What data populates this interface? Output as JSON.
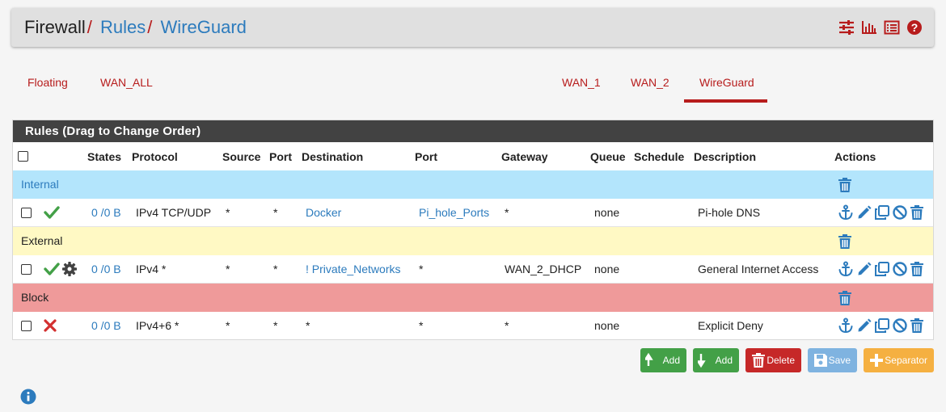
{
  "breadcrumb": {
    "root": "Firewall",
    "sep1": "/",
    "rules": "Rules",
    "sep2": "/",
    "current": "WireGuard"
  },
  "header_icons": [
    "sliders-icon",
    "bar-chart-icon",
    "list-icon",
    "help-icon"
  ],
  "tabs": [
    {
      "label": "Floating",
      "active": false
    },
    {
      "label": "WAN_ALL",
      "active": false
    },
    {
      "label": "WAN_1",
      "active": false
    },
    {
      "label": "WAN_2",
      "active": false
    },
    {
      "label": "WireGuard",
      "active": true
    }
  ],
  "panel": {
    "title": "Rules (Drag to Change Order)"
  },
  "columns": [
    "States",
    "Protocol",
    "Source",
    "Port",
    "Destination",
    "Port",
    "Gateway",
    "Queue",
    "Schedule",
    "Description",
    "Actions"
  ],
  "separators": [
    {
      "label": "Internal",
      "color": "#b3e5fc"
    },
    {
      "label": "External",
      "color": "#fff9c4"
    },
    {
      "label": "Block",
      "color": "#ef9a9a"
    }
  ],
  "rows": [
    {
      "status": "pass",
      "advanced": false,
      "states": "0 /0 B",
      "protocol": "IPv4 TCP/UDP",
      "source": "*",
      "source_port": "*",
      "destination": "Docker",
      "dest_port": "Pi_hole_Ports",
      "gateway": "*",
      "queue": "none",
      "schedule": "",
      "description": "Pi-hole DNS"
    },
    {
      "status": "pass",
      "advanced": true,
      "states": "0 /0 B",
      "protocol": "IPv4 *",
      "source": "*",
      "source_port": "*",
      "destination": "! Private_Networks",
      "dest_port": "*",
      "gateway": "WAN_2_DHCP",
      "queue": "none",
      "schedule": "",
      "description": "General Internet Access"
    },
    {
      "status": "block",
      "advanced": false,
      "states": "0 /0 B",
      "protocol": "IPv4+6 *",
      "source": "*",
      "source_port": "*",
      "destination": "*",
      "dest_port": "*",
      "gateway": "*",
      "queue": "none",
      "schedule": "",
      "description": "Explicit Deny"
    }
  ],
  "buttons": {
    "add_top": "Add",
    "add_bottom": "Add",
    "delete": "Delete",
    "save": "Save",
    "separator": "Separator"
  },
  "colors": {
    "accent_red": "#b71c1c",
    "link_blue": "#2c7bbd",
    "pass_green": "#43a047",
    "block_red": "#d32f2f",
    "btn_green": "#43a047",
    "btn_red": "#c62828",
    "btn_save": "#7fb3e0",
    "btn_separator": "#f5b041"
  }
}
